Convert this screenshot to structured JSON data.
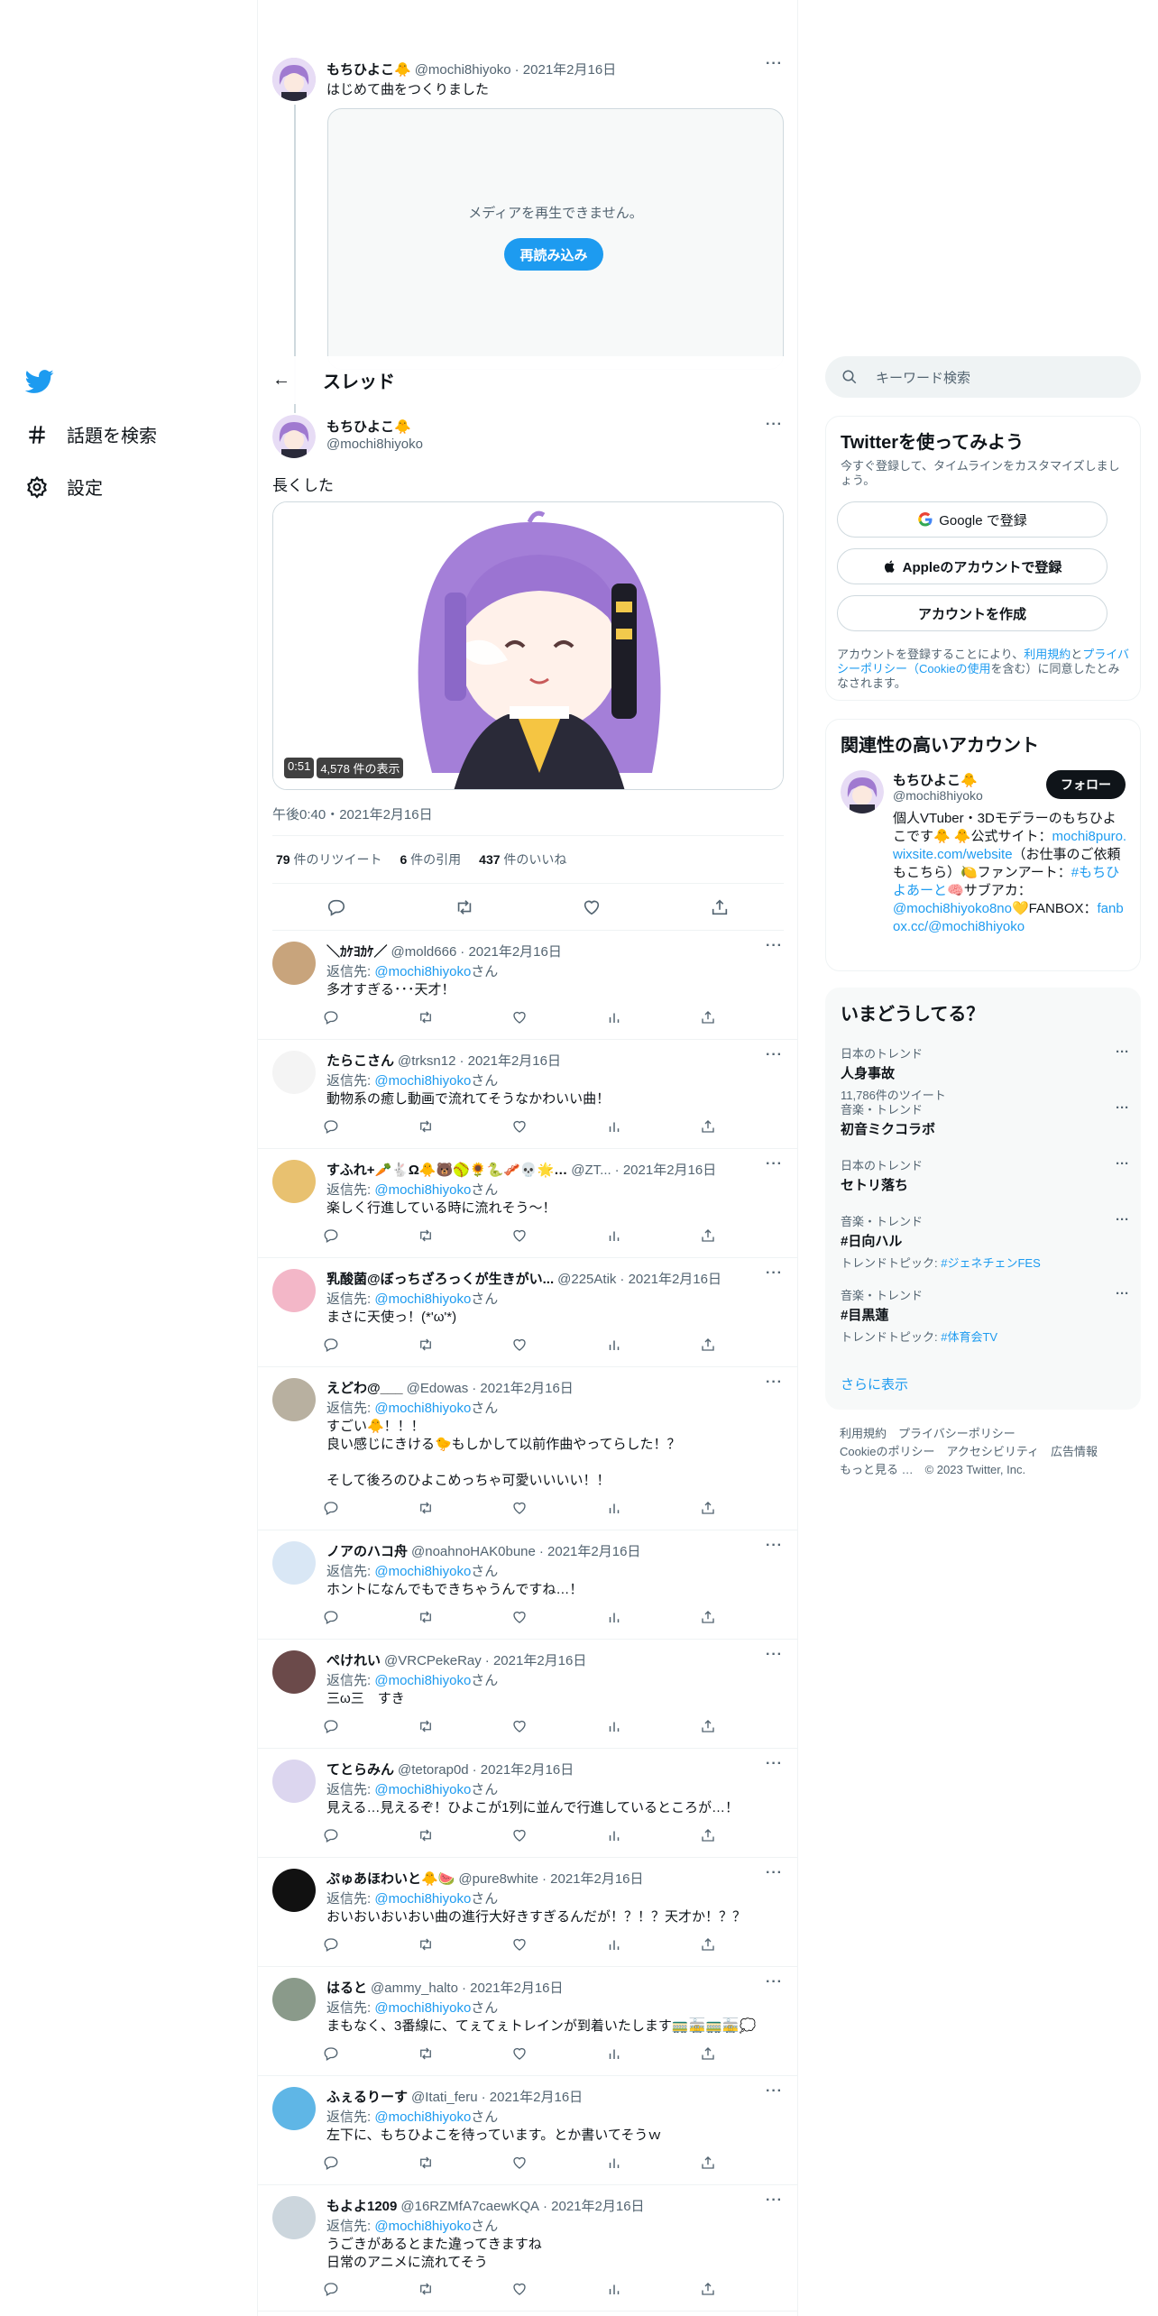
{
  "nav": {
    "explore_label": "話題を検索",
    "settings_label": "設定"
  },
  "thread_header": {
    "title": "スレッド",
    "back": "←"
  },
  "parent_tweet": {
    "name": "もちひよこ🐥",
    "handle": "@mochi8hiyoko",
    "date": "· 2021年2月16日",
    "text": "はじめて曲をつくりました",
    "media_error": "メディアを再生できません。",
    "reload_label": "再読み込み"
  },
  "main_tweet": {
    "name": "もちひよこ🐥",
    "handle": "@mochi8hiyoko",
    "text": "長くした",
    "video_duration": "0:51",
    "video_views": "4,578 件の表示",
    "timestamp": "午後0:40・2021年2月16日",
    "retweets": "79",
    "retweets_label": "件のリツイート",
    "quotes": "6",
    "quotes_label": "件の引用",
    "likes": "437",
    "likes_label": "件のいいね"
  },
  "replying_prefix": "返信先: ",
  "replying_handle": "@mochi8hiyoko",
  "replying_suffix": "さん",
  "replies": [
    {
      "name": "＼ｶｹﾖｶｹ／",
      "handle": "@mold666",
      "date": "· 2021年2月16日",
      "text": "多才すぎる･･･天才！",
      "avatar_color": "#c8a47c"
    },
    {
      "name": "たらこさん",
      "handle": "@trksn12",
      "date": "· 2021年2月16日",
      "text": "動物系の癒し動画で流れてそうなかわいい曲！",
      "avatar_color": "#f4f4f4"
    },
    {
      "name": "すふれ+🥕🐇Ω🐥🐻🥎🌻🐍🥓💀🌟…",
      "handle": "@ZT...",
      "date": "· 2021年2月16日",
      "text": "楽しく行進している時に流れそう～！",
      "avatar_color": "#e8c170"
    },
    {
      "name": "乳酸菌@ぼっちざろっくが生きがい...",
      "handle": "@225Atik",
      "date": "· 2021年2月16日",
      "text": "まさに天使っ！(*'ω'*)",
      "avatar_color": "#f3b7c8"
    },
    {
      "name": "えどわ@___",
      "handle": "@Edowas",
      "date": "· 2021年2月16日",
      "text": "すごい🐥！！！\n良い感じにきける🐤もしかして以前作曲やってらした！？\n\nそして後ろのひよこめっちゃ可愛いいいい！！",
      "avatar_color": "#b8b0a0"
    },
    {
      "name": "ノアのハコ舟",
      "handle": "@noahnoHAK0bune",
      "date": "· 2021年2月16日",
      "text": "ホントになんでもできちゃうんですね…！",
      "avatar_color": "#d9e7f5"
    },
    {
      "name": "ぺけれい",
      "handle": "@VRCPekeRay",
      "date": "· 2021年2月16日",
      "text": "三ω三　すき",
      "avatar_color": "#6b4a4a"
    },
    {
      "name": "てとらみん",
      "handle": "@tetorap0d",
      "date": "· 2021年2月16日",
      "text": "見える…見えるぞ！ひよこが1列に並んで行進しているところが…！",
      "avatar_color": "#dcd6ef"
    },
    {
      "name": "ぷゅあほわいと🐥🍉",
      "handle": "@pure8white",
      "date": "· 2021年2月16日",
      "text": "おいおいおいおい曲の進行大好きすぎるんだが！？！？天才か！？？",
      "avatar_color": "#111111"
    },
    {
      "name": "はると",
      "handle": "@ammy_halto",
      "date": "· 2021年2月16日",
      "text": "まもなく、3番線に、てぇてぇトレインが到着いたします🚃🚋🚃🚋💭",
      "avatar_color": "#8a9a8a"
    },
    {
      "name": "ふぇるりーす",
      "handle": "@Itati_feru",
      "date": "· 2021年2月16日",
      "text": "左下に、もちひよこを待っています。とか書いてそうｗ",
      "avatar_color": "#5fb6e6"
    },
    {
      "name": "もよよ1209",
      "handle": "@16RZMfA7caewKQA",
      "date": "· 2021年2月16日",
      "text": "うごきがあるとまた違ってきますね\n日常のアニメに流れてそう",
      "avatar_color": "#ccd6dd"
    }
  ],
  "sidebar": {
    "search_placeholder": "キーワード検索",
    "signup": {
      "title": "Twitterを使ってみよう",
      "desc": "今すぐ登録して、タイムラインをカスタマイズしましょう。",
      "google": "Google で登録",
      "apple": "Appleのアカウントで登録",
      "create": "アカウントを作成",
      "legal_1": "アカウントを登録することにより、",
      "legal_terms": "利用規約",
      "legal_2": "と",
      "legal_privacy": "プライバシーポリシー（Cookieの使用",
      "legal_3": "を含む）に同意したとみなされます。"
    },
    "related": {
      "title": "関連性の高いアカウント",
      "name": "もちひよこ🐥",
      "handle": "@mochi8hiyoko",
      "follow": "フォロー",
      "bio_1": "個人VTuber・3Dモデラーのもちひよこです🐥 🐥公式サイト：",
      "bio_link1": "mochi8puro.wixsite.com/website",
      "bio_2": "（お仕事のご依頼もこちら）🍋ファンアート：",
      "bio_tag": "#もちひよあーと",
      "bio_3": "🧠サブアカ：",
      "bio_sub": "@mochi8hiyoko8no",
      "bio_4": "💛FANBOX：",
      "bio_link2": "fanbox.cc/@mochi8hiyoko"
    },
    "trends": {
      "title": "いまどうしてる？",
      "items": [
        {
          "cat": "日本のトレンド",
          "name": "人身事故",
          "sub": "11,786件のツイート",
          "sub_link": ""
        },
        {
          "cat": "音楽・トレンド",
          "name": "初音ミクコラボ",
          "sub": "",
          "sub_link": ""
        },
        {
          "cat": "日本のトレンド",
          "name": "セトリ落ち",
          "sub": "",
          "sub_link": ""
        },
        {
          "cat": "音楽・トレンド",
          "name": "#日向ハル",
          "sub": "トレンドトピック: ",
          "sub_link": "#ジェネチェンFES"
        },
        {
          "cat": "音楽・トレンド",
          "name": "#目黒蓮",
          "sub": "トレンドトピック: ",
          "sub_link": "#体育会TV"
        }
      ],
      "show_more": "さらに表示"
    },
    "footer": {
      "line1": "利用規約　プライバシーポリシー",
      "line2": "Cookieのポリシー　アクセシビリティ　広告情報",
      "line3": "もっと見る …　© 2023 Twitter, Inc."
    }
  },
  "colors": {
    "accent": "#1d9bf0",
    "text": "#0f1419",
    "muted": "#536471"
  }
}
